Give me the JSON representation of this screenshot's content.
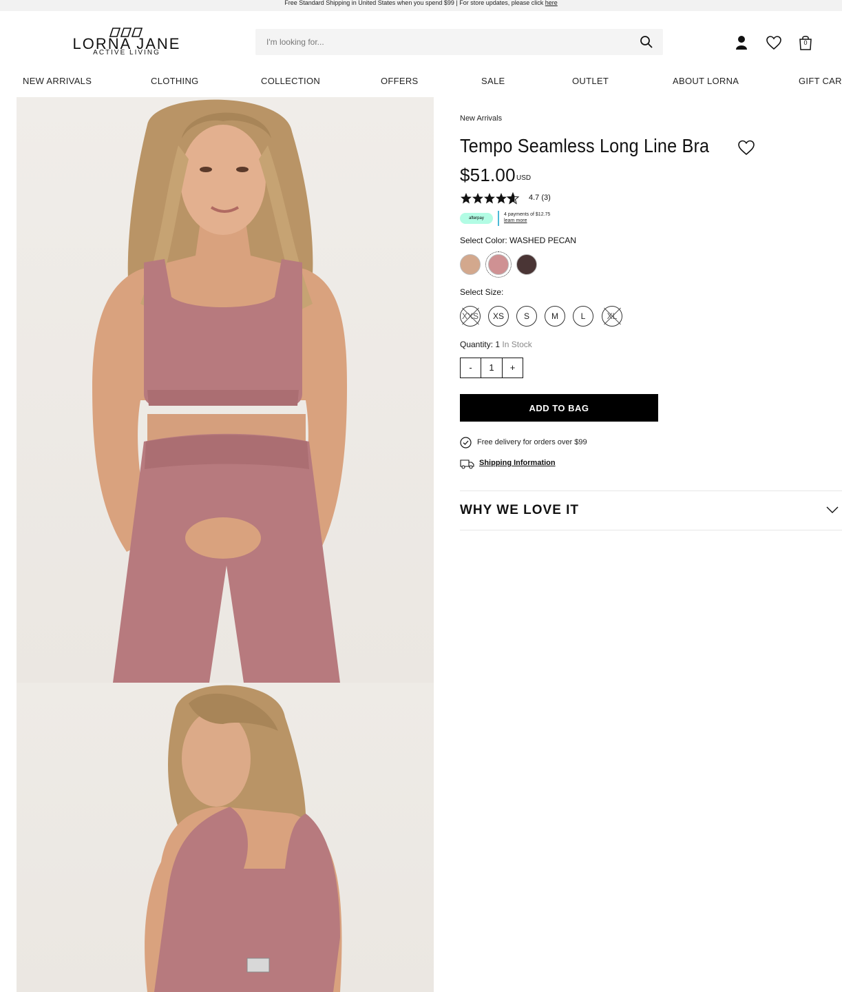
{
  "promo": {
    "text": "Free Standard Shipping in United States when you spend $99 | For store updates, please click",
    "link": "here"
  },
  "header": {
    "logo_name": "LORNA JANE",
    "logo_tagline": "ACTIVE LIVING",
    "search_placeholder": "I'm looking for...",
    "bag_count": "0",
    "icons": [
      "search-icon",
      "account-icon",
      "wishlist-icon",
      "bag-icon"
    ]
  },
  "nav": [
    "NEW ARRIVALS",
    "CLOTHING",
    "COLLECTION",
    "OFFERS",
    "SALE",
    "OUTLET",
    "ABOUT LORNA",
    "GIFT CARDS"
  ],
  "product": {
    "breadcrumb": "New Arrivals",
    "title": "Tempo Seamless Long Line Bra",
    "price": "$51.00",
    "currency": "USD",
    "rating_stars": 4.7,
    "rating_text": "4.7 (3)",
    "afterpay_badge": "afterpay",
    "afterpay_line1": "4 payments of $12.75",
    "afterpay_link": "learn more",
    "color_label": "Select Color:",
    "color_value": "WASHED PECAN",
    "colors": [
      {
        "name": "tan",
        "hex": "#d3a88d",
        "selected": false
      },
      {
        "name": "washed pecan",
        "hex": "#cf9193",
        "selected": true
      },
      {
        "name": "dark brown",
        "hex": "#4a3535",
        "selected": false
      }
    ],
    "size_label": "Select Size:",
    "sizes": [
      {
        "label": "XXS",
        "available": false
      },
      {
        "label": "XS",
        "available": true
      },
      {
        "label": "S",
        "available": true
      },
      {
        "label": "M",
        "available": true
      },
      {
        "label": "L",
        "available": true
      },
      {
        "label": "XL",
        "available": false
      }
    ],
    "quantity_label": "Quantity:",
    "quantity_value": "1",
    "stock_text": "In Stock",
    "qty_minus": "-",
    "qty_plus": "+",
    "add_to_bag": "ADD TO BAG",
    "free_delivery": "Free delivery for orders over $99",
    "shipping_info": "Shipping Information",
    "accordion_title": "WHY WE LOVE IT"
  },
  "colors": {
    "accent": "#000000",
    "afterpay": "#b2fce4",
    "garment": "#b77a7e"
  }
}
